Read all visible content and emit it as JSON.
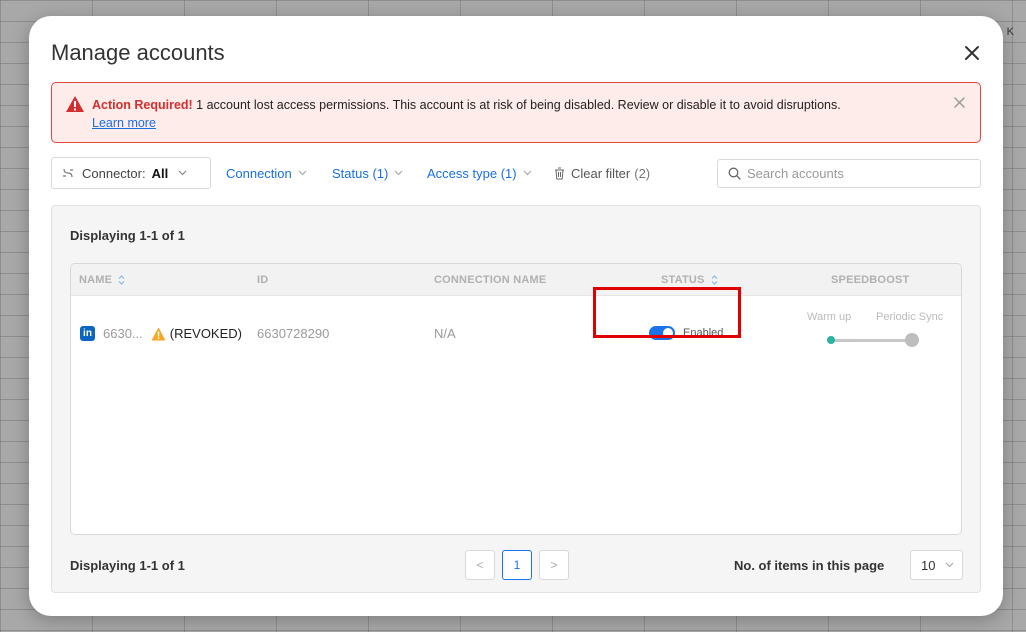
{
  "background": {
    "corner_text": "K"
  },
  "modal": {
    "title": "Manage accounts"
  },
  "alert": {
    "strong": "Action Required!",
    "message": " 1 account lost access permissions. This account is at risk of being disabled. Review or disable it to avoid disruptions.",
    "link": "Learn more"
  },
  "filters": {
    "connector_label": "Connector:",
    "connector_value": "All",
    "connection": "Connection",
    "status": "Status (1)",
    "access_type": "Access type (1)",
    "clear_filter": "Clear filter",
    "clear_filter_count": "(2)",
    "search_placeholder": "Search accounts"
  },
  "table": {
    "displaying_top": "Displaying 1-1 of 1",
    "displaying_bottom": "Displaying 1-1 of 1",
    "columns": {
      "name": "NAME",
      "id": "ID",
      "connection_name": "CONNECTION NAME",
      "status": "STATUS",
      "speedboost": "SPEEDBOOST"
    },
    "rows": [
      {
        "icon_badge": "in",
        "name": "6630...",
        "tag": "(REVOKED)",
        "id": "6630728290",
        "connection_name": "N/A",
        "status": "Enabled",
        "speedboost_left": "Warm up",
        "speedboost_right": "Periodic Sync"
      }
    ]
  },
  "pagination": {
    "prev": "<",
    "current": "1",
    "next": ">",
    "items_label": "No. of items in this page",
    "items_value": "10"
  },
  "colors": {
    "accent": "#1a73e8",
    "alert_border": "#e0463d",
    "alert_bg": "#fdecea",
    "highlight": "#e00000",
    "linkedin": "#0a66c2"
  }
}
